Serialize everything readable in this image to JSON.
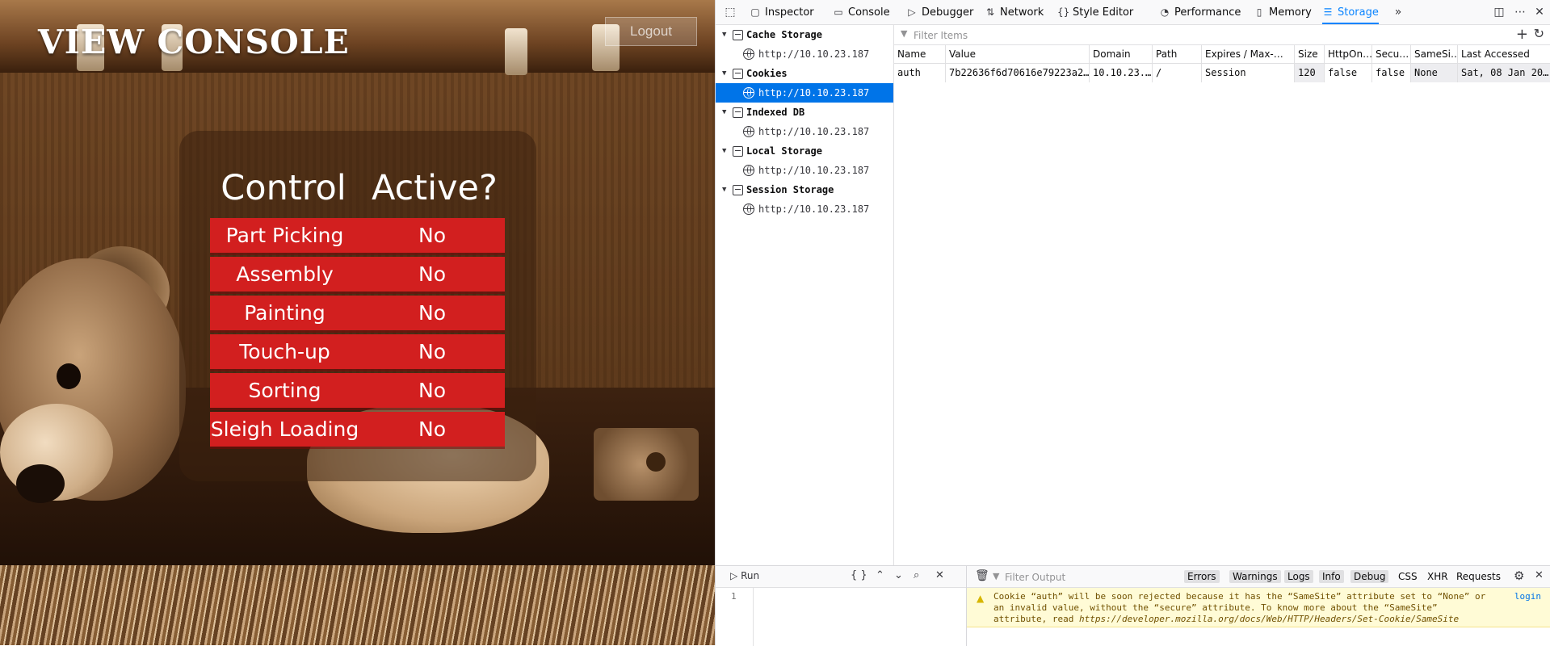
{
  "site": {
    "title": "VIEW CONSOLE",
    "logout_label": "Logout",
    "table": {
      "headers": [
        "Control",
        "Active?"
      ],
      "rows": [
        {
          "control": "Part Picking",
          "active": "No"
        },
        {
          "control": "Assembly",
          "active": "No"
        },
        {
          "control": "Painting",
          "active": "No"
        },
        {
          "control": "Touch-up",
          "active": "No"
        },
        {
          "control": "Sorting",
          "active": "No"
        },
        {
          "control": "Sleigh Loading",
          "active": "No"
        }
      ],
      "row_color": "#d21f1f"
    }
  },
  "devtools": {
    "tabs": [
      {
        "label": "Inspector",
        "icon": "inspector-icon"
      },
      {
        "label": "Console",
        "icon": "console-icon"
      },
      {
        "label": "Debugger",
        "icon": "debugger-icon"
      },
      {
        "label": "Network",
        "icon": "network-icon"
      },
      {
        "label": "Style Editor",
        "icon": "style-editor-icon"
      },
      {
        "label": "Performance",
        "icon": "performance-icon"
      },
      {
        "label": "Memory",
        "icon": "memory-icon"
      },
      {
        "label": "Storage",
        "icon": "storage-icon"
      }
    ],
    "active_tab": "Storage",
    "accent_color": "#0a84ff",
    "tree": {
      "categories": [
        {
          "label": "Cache Storage",
          "host": "http://10.10.23.187"
        },
        {
          "label": "Cookies",
          "host": "http://10.10.23.187",
          "selected": true
        },
        {
          "label": "Indexed DB",
          "host": "http://10.10.23.187"
        },
        {
          "label": "Local Storage",
          "host": "http://10.10.23.187"
        },
        {
          "label": "Session Storage",
          "host": "http://10.10.23.187"
        }
      ]
    },
    "filter_placeholder": "Filter Items",
    "columns": [
      "Name",
      "Value",
      "Domain",
      "Path",
      "Expires / Max-…",
      "Size",
      "HttpOn…",
      "Secu…",
      "SameSi…",
      "Last Accessed"
    ],
    "cookie": {
      "name": "auth",
      "value": "7b22636f6d70616e79223a2…",
      "domain": "10.10.23.…",
      "path": "/",
      "expires": "Session",
      "size": "120",
      "httponly": "false",
      "secure": "false",
      "samesite": "None",
      "last_accessed": "Sat, 08 Jan 20…"
    },
    "console": {
      "run_label": "Run",
      "line_number": "1",
      "output_filter_placeholder": "Filter Output",
      "levels": [
        "Errors",
        "Warnings",
        "Logs",
        "Info",
        "Debug"
      ],
      "extra_filters": [
        "CSS",
        "XHR",
        "Requests"
      ],
      "message": "Cookie “auth” will be soon rejected because it has the “SameSite” attribute set to “None” or an invalid value, without the “secure” attribute. To know more about the “SameSite” attribute, read",
      "message_link": "https://developer.mozilla.org/docs/Web/HTTP/Headers/Set-Cookie/SameSite",
      "message_source": "login"
    }
  }
}
